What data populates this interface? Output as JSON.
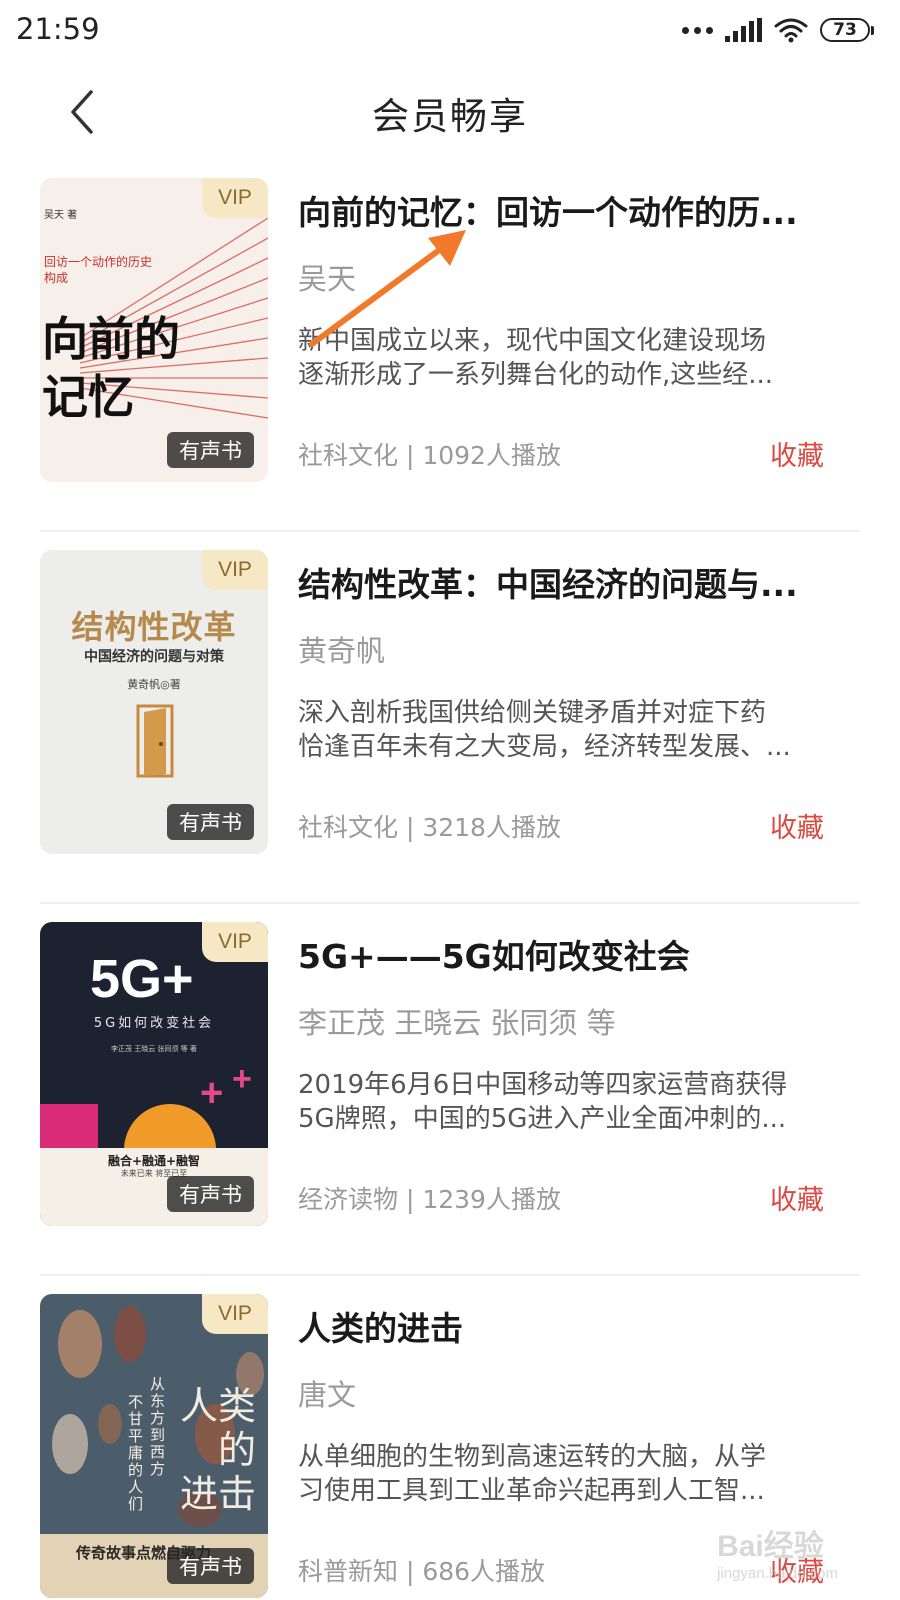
{
  "status_bar": {
    "time": "21:59",
    "battery": "73"
  },
  "header": {
    "title": "会员畅享"
  },
  "badges": {
    "vip": "VIP",
    "audio": "有声书"
  },
  "books": [
    {
      "title": "向前的记忆：回访一个动作的历...",
      "author": "吴天",
      "desc_lines": [
        "新中国成立以来，现代中国文化建设现场",
        "逐渐形成了一系列舞台化的动作,这些经..."
      ],
      "category": "社科文化",
      "plays": "1092人播放",
      "fav": "收藏",
      "cover": {
        "author": "吴天 著",
        "subtitle": "回访一个动作的历史构成",
        "main": [
          "向前的",
          "记忆"
        ]
      }
    },
    {
      "title": "结构性改革：中国经济的问题与...",
      "author": "黄奇帆",
      "desc_lines": [
        "深入剖析我国供给侧关键矛盾并对症下药",
        "恰逢百年未有之大变局，经济转型发展、..."
      ],
      "category": "社科文化",
      "plays": "3218人播放",
      "fav": "收藏",
      "cover": {
        "main": "结构性改革",
        "subtitle": "中国经济的问题与对策",
        "author": "黄奇帆◎著"
      }
    },
    {
      "title": "5G+——5G如何改变社会",
      "author": "李正茂 王晓云 张同须 等",
      "desc_lines": [
        "2019年6月6日中国移动等四家运营商获得",
        "5G牌照，中国的5G进入产业全面冲刺的..."
      ],
      "category": "经济读物",
      "plays": "1239人播放",
      "fav": "收藏",
      "cover": {
        "main": "5G+",
        "subtitle": "5G如何改变社会",
        "authors": "李正茂  王晓云  张同须  等  著",
        "slogan": "融合+融通+融智",
        "tagline": "未来已来  将至已至"
      }
    },
    {
      "title": "人类的进击",
      "author": "唐文",
      "desc_lines": [
        "从单细胞的生物到高速运转的大脑，从学",
        "习使用工具到工业革命兴起再到人工智..."
      ],
      "category": "科普新知",
      "plays": "686人播放",
      "fav": "收藏",
      "cover": {
        "main": [
          "人类",
          "的",
          "进击"
        ],
        "side": "从东方到西方",
        "side2": "不甘平庸的人们",
        "bottom": "传奇故事点燃自驱力"
      }
    }
  ],
  "separator": " | ",
  "watermark": {
    "brand": "Bai经验",
    "url": "jingyan.baidu.com"
  },
  "colors": {
    "accent_red": "#d94b42",
    "vip_bg": "#f6e8c4",
    "annotation_arrow": "#f07a2a"
  },
  "icons": [
    "back-arrow-icon",
    "signal-dots-icon",
    "cell-signal-icon",
    "wifi-icon",
    "battery-icon"
  ]
}
